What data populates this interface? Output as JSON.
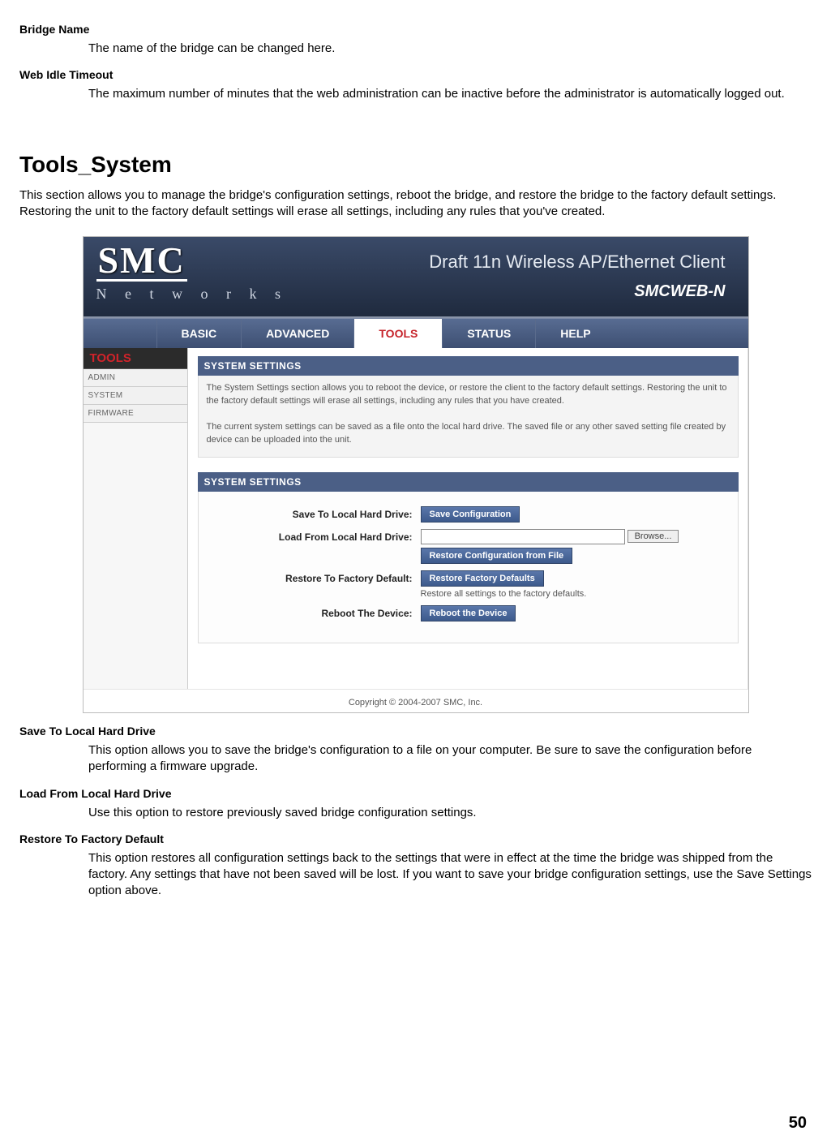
{
  "doc": {
    "defs": [
      {
        "term": "Bridge Name",
        "body": "The name of the bridge can be changed here."
      },
      {
        "term": "Web Idle Timeout",
        "body": "The maximum number of minutes that the web administration can be inactive before the administrator is automatically logged out."
      }
    ],
    "section_title": "Tools_System",
    "section_intro": "This section allows you to manage the bridge's configuration settings, reboot the bridge, and restore the bridge to the factory default settings. Restoring the unit to the factory default settings will erase all settings, including any rules that you've created.",
    "defs2": [
      {
        "term": "Save To Local Hard Drive",
        "body": "This option allows you to save the bridge's configuration to a file on your computer. Be sure to save the configuration before performing a firmware upgrade."
      },
      {
        "term": "Load From Local Hard Drive",
        "body": "Use this option to restore previously saved bridge configuration settings."
      },
      {
        "term": "Restore To Factory Default",
        "body": "This option restores all configuration settings back to the settings that were in effect at the time the bridge was shipped from the factory. Any settings that have not been saved will be lost. If you want to save your bridge configuration settings, use the Save Settings option above."
      }
    ],
    "page_number": "50"
  },
  "shot": {
    "logo_top": "SMC",
    "logo_bottom": "N e t w o r k s",
    "tagline": "Draft 11n Wireless AP/Ethernet Client",
    "model": "SMCWEB-N",
    "topnav": [
      "BASIC",
      "ADVANCED",
      "TOOLS",
      "STATUS",
      "HELP"
    ],
    "topnav_active_index": 2,
    "sidebar_title": "TOOLS",
    "sidebar_items": [
      "ADMIN",
      "SYSTEM",
      "FIRMWARE"
    ],
    "panel1_title": "SYSTEM SETTINGS",
    "panel1_p1": "The System Settings section allows you to reboot the device, or restore the client to the factory default settings. Restoring the unit to the factory default settings will erase all settings, including any rules that you have created.",
    "panel1_p2": "The current system settings can be saved as a file onto the local hard drive. The saved file or any other saved setting file created by device can be uploaded into the unit.",
    "panel2_title": "SYSTEM  SETTINGS",
    "form": {
      "save_label": "Save To Local Hard Drive:",
      "save_btn": "Save Configuration",
      "load_label": "Load From Local Hard Drive:",
      "browse_btn": "Browse...",
      "load_btn": "Restore Configuration from File",
      "restore_label": "Restore To Factory Default:",
      "restore_btn": "Restore Factory Defaults",
      "restore_hint": "Restore all settings to the factory defaults.",
      "reboot_label": "Reboot The Device:",
      "reboot_btn": "Reboot the Device"
    },
    "copyright": "Copyright © 2004-2007 SMC, Inc."
  }
}
